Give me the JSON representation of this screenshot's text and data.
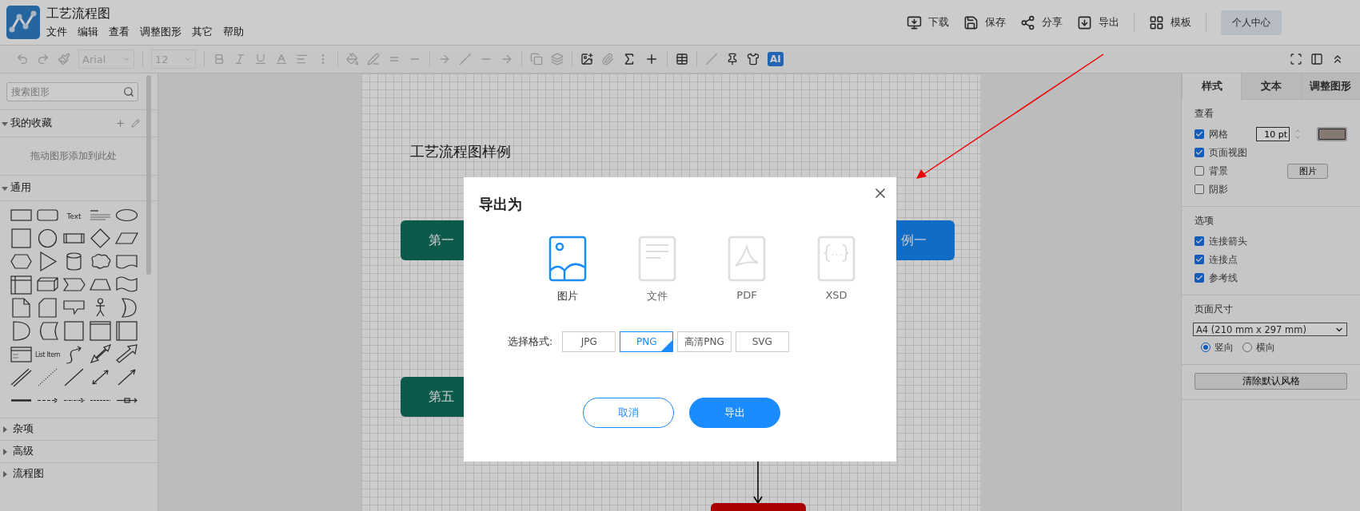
{
  "header": {
    "title": "工艺流程图",
    "menu": [
      "文件",
      "编辑",
      "查看",
      "调整图形",
      "其它",
      "帮助"
    ],
    "actions": [
      {
        "kind": "download",
        "label": "下载"
      },
      {
        "kind": "save",
        "label": "保存"
      },
      {
        "kind": "share",
        "label": "分享"
      },
      {
        "kind": "export",
        "label": "导出"
      },
      {
        "kind": "template",
        "label": "模板"
      }
    ],
    "account_button": "个人中心"
  },
  "toolbar": {
    "font": "Arial",
    "font_size": "12",
    "ai_badge": "AI"
  },
  "sidebar": {
    "search": {
      "placeholder": "搜索图形"
    },
    "favorites": {
      "label": "我的收藏",
      "expanded": true,
      "hint": "拖动图形添加到此处"
    },
    "general": {
      "label": "通用",
      "expanded": true,
      "shapes": [
        {
          "kind": "rect"
        },
        {
          "kind": "rounded"
        },
        {
          "kind": "text",
          "label": "Text"
        },
        {
          "kind": "heading"
        },
        {
          "kind": "ellipse"
        },
        {
          "kind": "square"
        },
        {
          "kind": "circle"
        },
        {
          "kind": "process"
        },
        {
          "kind": "diamond"
        },
        {
          "kind": "parallelogram"
        },
        {
          "kind": "hexagon"
        },
        {
          "kind": "triangle"
        },
        {
          "kind": "cylinder"
        },
        {
          "kind": "cloud"
        },
        {
          "kind": "document"
        },
        {
          "kind": "storage"
        },
        {
          "kind": "cube"
        },
        {
          "kind": "step"
        },
        {
          "kind": "trapezoid"
        },
        {
          "kind": "tape"
        },
        {
          "kind": "note"
        },
        {
          "kind": "card"
        },
        {
          "kind": "callout"
        },
        {
          "kind": "actor"
        },
        {
          "kind": "crescent"
        },
        {
          "kind": "delay"
        },
        {
          "kind": "stored"
        },
        {
          "kind": "square"
        },
        {
          "kind": "container"
        },
        {
          "kind": "swimlane"
        },
        {
          "kind": "list"
        },
        {
          "kind": "list-item",
          "label": "List Item"
        },
        {
          "kind": "curve"
        },
        {
          "kind": "double-arrow"
        },
        {
          "kind": "block-arrow"
        },
        {
          "kind": "link"
        },
        {
          "kind": "dotted"
        },
        {
          "kind": "line"
        },
        {
          "kind": "both-arrow"
        },
        {
          "kind": "arrow"
        },
        {
          "kind": "thick"
        },
        {
          "kind": "dash-arrow"
        },
        {
          "kind": "dashdot-arrow"
        },
        {
          "kind": "dash-line"
        },
        {
          "kind": "connector"
        }
      ]
    },
    "sections": [
      {
        "label": "杂项",
        "expanded": false
      },
      {
        "label": "高级",
        "expanded": false
      },
      {
        "label": "流程图",
        "expanded": false
      }
    ]
  },
  "canvas": {
    "page_title": "工艺流程图样例",
    "nodes": [
      {
        "label": "第一",
        "color": "#0b5a4c"
      },
      {
        "label": "第五",
        "color": "#0b5a4c"
      },
      {
        "label": "例一",
        "color": "#106cc4"
      },
      {
        "color": "#aa0000"
      }
    ]
  },
  "right_panel": {
    "tabs": [
      {
        "label": "样式",
        "selected": true
      },
      {
        "label": "文本",
        "selected": false
      },
      {
        "label": "调整图形",
        "selected": false
      }
    ],
    "view": {
      "title": "查看",
      "items": [
        {
          "label": "网格",
          "checked": true
        },
        {
          "label": "页面视图",
          "checked": true
        },
        {
          "label": "背景",
          "checked": false
        },
        {
          "label": "阴影",
          "checked": false
        }
      ],
      "grid_size": "10 pt",
      "image_button": "图片"
    },
    "options": {
      "title": "选项",
      "items": [
        {
          "label": "连接箭头",
          "checked": true
        },
        {
          "label": "连接点",
          "checked": true
        },
        {
          "label": "参考线",
          "checked": true
        }
      ]
    },
    "page_size": {
      "title": "页面尺寸",
      "value": "A4 (210 mm x 297 mm)",
      "orientations": [
        {
          "label": "竖向",
          "selected": true
        },
        {
          "label": "横向",
          "selected": false
        }
      ]
    },
    "reset_button": "清除默认风格"
  },
  "dialog": {
    "title": "导出为",
    "types": [
      {
        "kind": "image",
        "label": "图片",
        "selected": true
      },
      {
        "kind": "file",
        "label": "文件",
        "selected": false
      },
      {
        "kind": "pdf",
        "label": "PDF",
        "selected": false
      },
      {
        "kind": "xsd",
        "label": "XSD",
        "selected": false
      }
    ],
    "format_label": "选择格式:",
    "formats": [
      {
        "label": "JPG",
        "selected": false
      },
      {
        "label": "PNG",
        "selected": true
      },
      {
        "label": "高清PNG",
        "selected": false
      },
      {
        "label": "SVG",
        "selected": false
      }
    ],
    "cancel": "取消",
    "confirm": "导出"
  }
}
